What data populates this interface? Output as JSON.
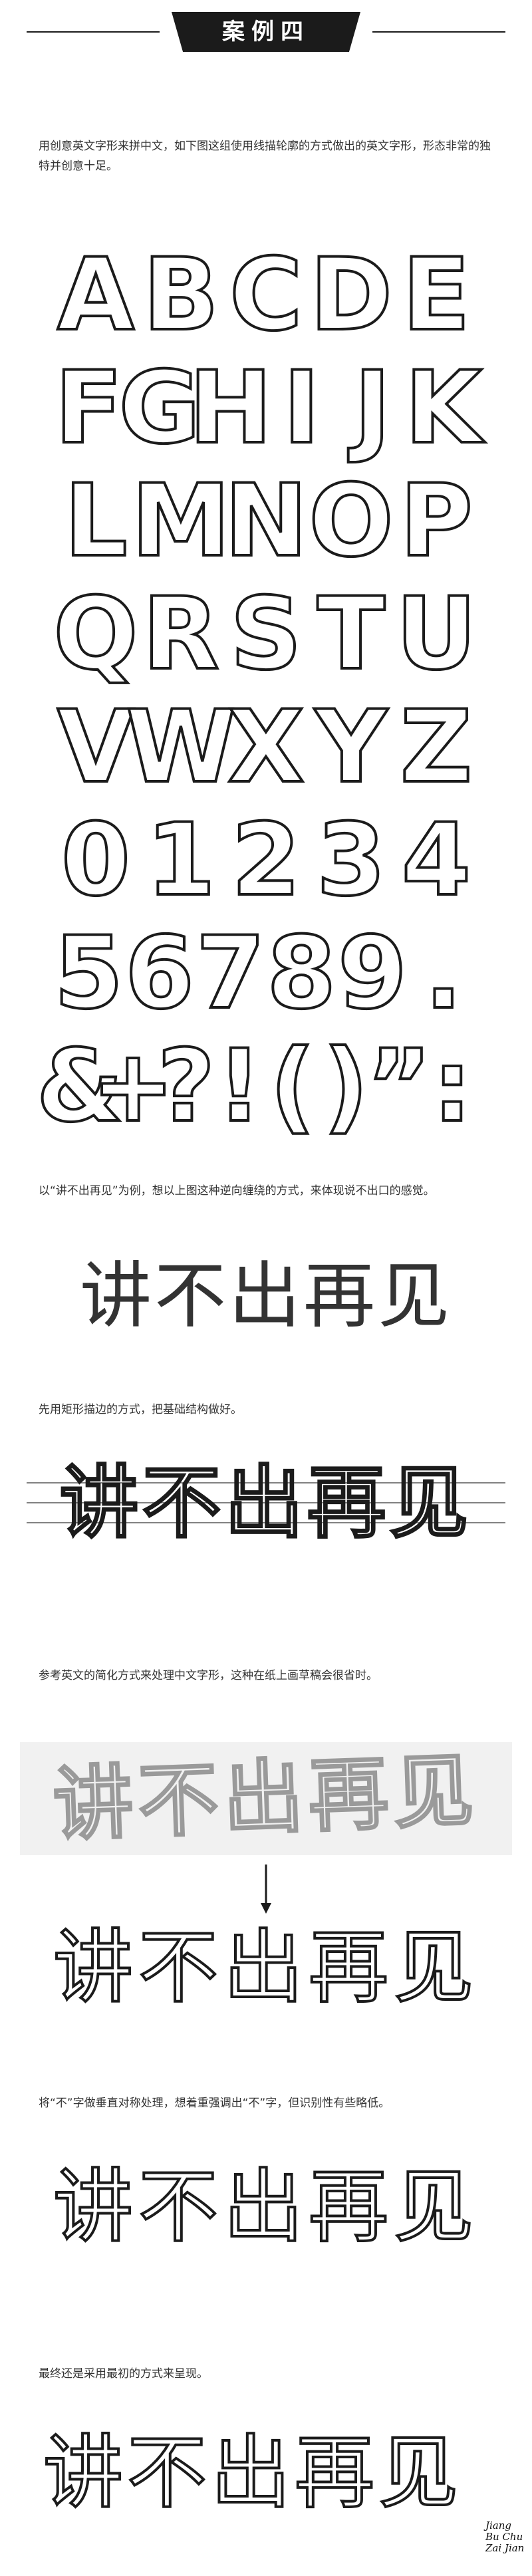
{
  "banner": {
    "title": "案例四"
  },
  "paragraphs": {
    "p1": "用创意英文字形来拼中文，如下图这组使用线描轮廓的方式做出的英文字形，形态非常的独特并创意十足。",
    "p2": "以“讲不出再见”为例，想以上图这种逆向缠绕的方式，来体现说不出口的感觉。",
    "p3": "先用矩形描边的方式，把基础结构做好。",
    "p4": "参考英文的简化方式来处理中文字形，这种在纸上画草稿会很省时。",
    "p5": "将“不”字做垂直对称处理，想着重强调出“不”字，但识别性有些略低。",
    "p6": "最终还是采用最初的方式来呈现。"
  },
  "alphabet_rows": [
    [
      "A",
      "B",
      "C",
      "D",
      "E"
    ],
    [
      "F",
      "G",
      "H",
      "I",
      "J",
      "K"
    ],
    [
      "L",
      "M",
      "N",
      "O",
      "P"
    ],
    [
      "Q",
      "R",
      "S",
      "T",
      "U"
    ],
    [
      "V",
      "W",
      "X",
      "Y",
      "Z"
    ],
    [
      "0",
      "1",
      "2",
      "3",
      "4"
    ],
    [
      "5",
      "6",
      "7",
      "8",
      "9",
      "."
    ],
    [
      "&",
      "+",
      "?",
      "!",
      "(",
      ")",
      "”",
      ":"
    ]
  ],
  "phrase": "讲不出再见",
  "signature": {
    "line1": "Jiang",
    "line2": "Bu Chu",
    "line3": "Zai Jian"
  },
  "colors": {
    "ink": "#1b1b1b",
    "sketch_gray": "#9a9a9a"
  }
}
